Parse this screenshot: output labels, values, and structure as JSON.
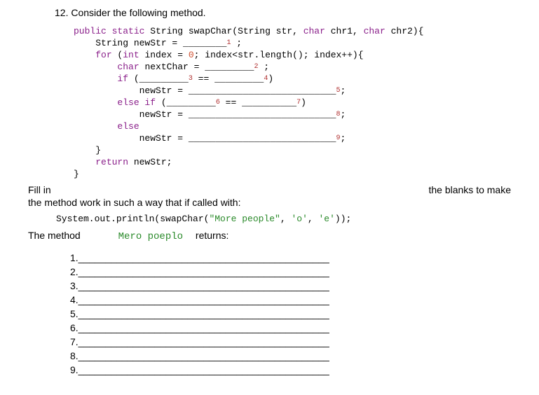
{
  "question_number": "12. Consider the following method.",
  "code": {
    "l1a": "public static",
    "l1b": "String",
    "l1c": "swapChar(String str,",
    "l1d": "char",
    "l1e": "chr1,",
    "l1f": "char",
    "l1g": "chr2){",
    "l2a": "String newStr = ",
    "l2blank": "________",
    "l2sub": "1",
    "l2end": " ;",
    "l3a": "for",
    "l3b": " (",
    "l3c": "int",
    "l3d": " index = ",
    "l3num": "0",
    "l3e": "; index<str.length(); index++){",
    "l4a": "char",
    "l4b": " nextChar = ",
    "l4blank": "_________",
    "l4sub": "2",
    "l4end": " ;",
    "l5a": "if",
    "l5b": " (",
    "l5blank1": "_________",
    "l5sub1": "3",
    "l5mid": " == ",
    "l5blank2": "_________",
    "l5sub2": "4",
    "l5end": ")",
    "l6a": "newStr = ",
    "l6blank": "___________________________",
    "l6sub": "5",
    "l6end": ";",
    "l7a": "else if",
    "l7b": " (",
    "l7blank1": "_________",
    "l7sub1": "6",
    "l7mid": " == ",
    "l7blank2": "__________",
    "l7sub2": "7",
    "l7end": ")",
    "l8a": "newStr = ",
    "l8blank": "___________________________",
    "l8sub": "8",
    "l8end": ";",
    "l9a": "else",
    "l10a": "newStr = ",
    "l10blank": "___________________________",
    "l10sub": "9",
    "l10end": ";",
    "l11": "}",
    "l12a": "return",
    "l12b": " newStr;",
    "l13": "}"
  },
  "fillin_left": "Fill in",
  "fillin_right": "the  blanks to make",
  "fillin_line2": "the method work in such a way that if called with:",
  "call": {
    "pre": "System.out.println(swapChar(",
    "str": "\"More people\"",
    "mid1": ", ",
    "c1": "'o'",
    "mid2": ", ",
    "c2": "'e'",
    "post": "));"
  },
  "returns_left": "The method",
  "returns_mid": "Mero poeplo",
  "returns_right": "returns:",
  "answers": {
    "a1": "1.______________________________________________",
    "a2": "2.______________________________________________",
    "a3": "3.______________________________________________",
    "a4": "4.______________________________________________",
    "a5": "5.______________________________________________",
    "a6": "6.______________________________________________",
    "a7": "7.______________________________________________",
    "a8": "8.______________________________________________",
    "a9": "9.______________________________________________"
  }
}
